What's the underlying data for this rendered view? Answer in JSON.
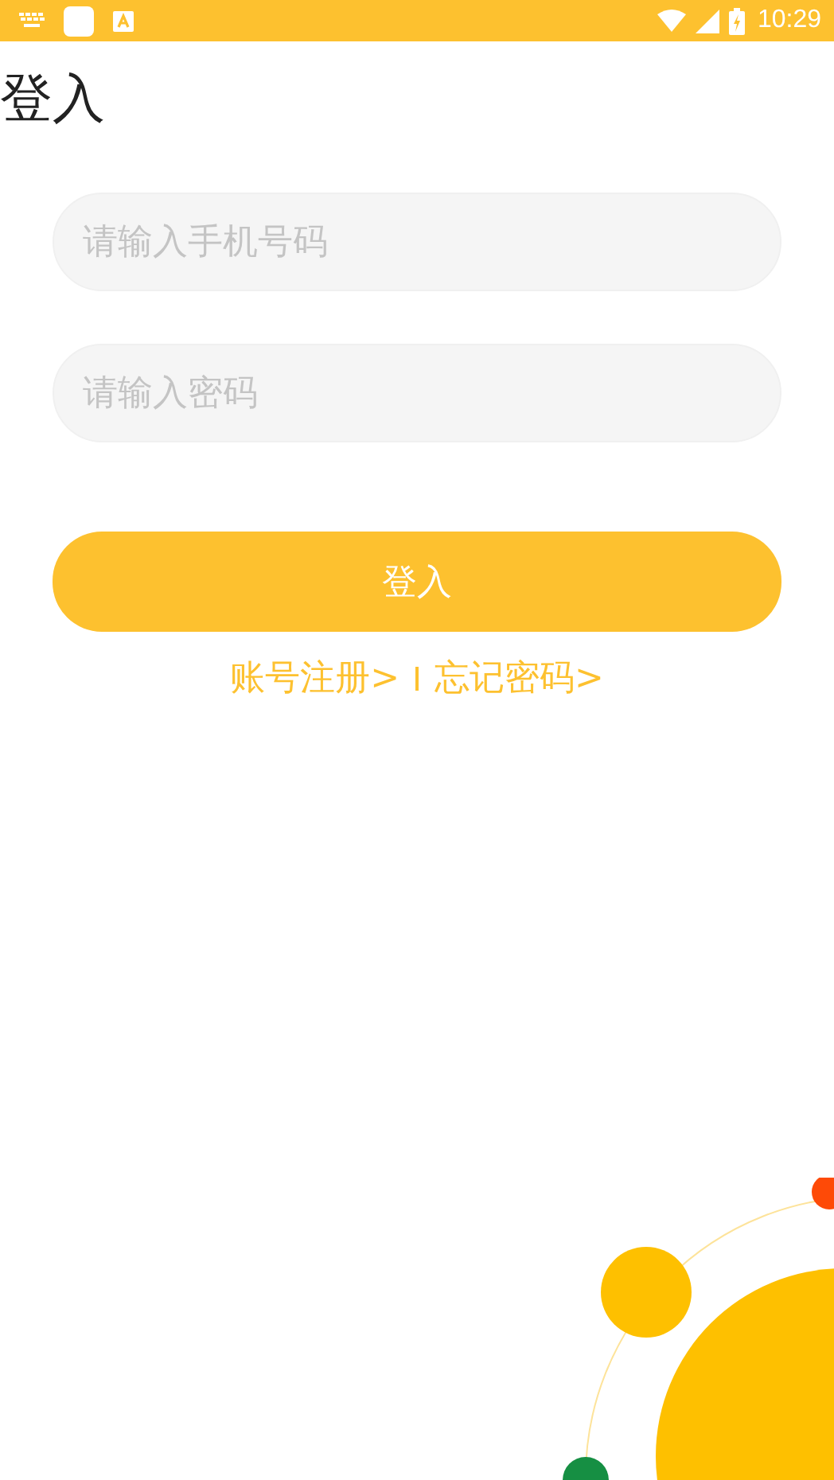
{
  "status_bar": {
    "time": "10:29"
  },
  "title": "登入",
  "fields": [
    {
      "placeholder": "请输入手机号码"
    },
    {
      "placeholder": "请输入密码"
    }
  ],
  "login_button": {
    "label": "登入"
  },
  "links": [
    {
      "label": "账号注册>"
    },
    {
      "label": "忘记密码>"
    }
  ]
}
